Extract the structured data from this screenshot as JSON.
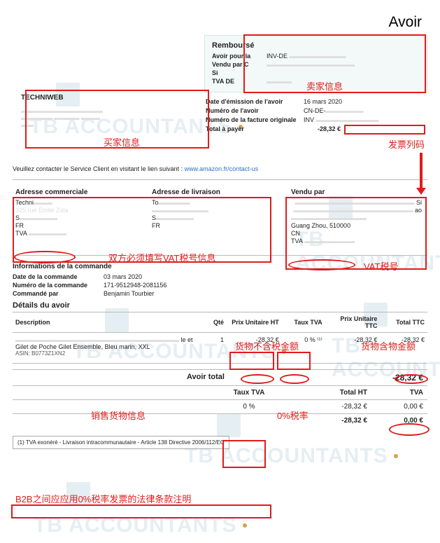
{
  "document_title": "Avoir",
  "watermark": "TB ACCOUNTANTS",
  "rembourse": {
    "heading": "Remboursé",
    "avoir_pour_label": "Avoir pour la",
    "avoir_pour_value": "INV-DE",
    "vendu_par_label": "Vendu par C",
    "si_label": "Si",
    "tva_label": "TVA DE"
  },
  "meta": {
    "date_emission_label": "Date d'émission de l'avoir",
    "date_emission_value": "16 mars 2020",
    "numero_avoir_label": "Numéro de l'avoir",
    "numero_avoir_value": "CN-DE-",
    "numero_facture_label": "Numéro de la facture originale",
    "numero_facture_value": "INV",
    "total_a_payer_label": "Total à payer",
    "total_a_payer_value": "-28,32 €"
  },
  "buyer": {
    "name": "TECHNIWEB"
  },
  "contact": {
    "text": "Veuillez contacter le Service Client en visitant le lien suivant :",
    "link_text": "www.amazon.fr/contact-us"
  },
  "addresses": {
    "commerciale": {
      "heading": "Adresse commerciale",
      "line1": "Techni",
      "line2": "325 rue Emile Zola",
      "line3": "S",
      "line4": "FR",
      "tva_label": "TVA"
    },
    "livraison": {
      "heading": "Adresse de livraison",
      "line1": "To",
      "line2": "",
      "line3": "S",
      "line4": "FR"
    },
    "vendu_par": {
      "heading": "Vendu par",
      "line1": "Si",
      "line2": "ao",
      "line4": "Guang Zhou, 510000",
      "line5": "CN",
      "tva_label": "TVA"
    }
  },
  "order_info": {
    "heading": "Informations de la commande",
    "date_label": "Date de la commande",
    "date_value": "03 mars 2020",
    "numero_label": "Numéro de la commande",
    "numero_value": "171-9512948-2081156",
    "commande_par_label": "Commandé par",
    "commande_par_value": "Benjamin Tourbier"
  },
  "details": {
    "heading": "Détails du avoir",
    "headers": {
      "description": "Description",
      "qte": "Qté",
      "prix_ht": "Prix Unitaire HT",
      "taux_tva": "Taux TVA",
      "prix_ttc": "Prix Unitaire TTC",
      "total_ttc": "Total TTC"
    },
    "items": [
      {
        "desc_suffix": "le et",
        "desc_line2": "Gilet de Poche Gilet Ensemble, Bleu marin, XXL",
        "asin": "ASIN: B0773Z1XN2",
        "qte": "1",
        "prix_ht": "-28,32 €",
        "taux_tva": "0 % ⁽¹⁾",
        "prix_ttc": "-28,32 €",
        "total_ttc": "-28,32 €"
      }
    ]
  },
  "totals": {
    "avoir_total_label": "Avoir total",
    "avoir_total_value": "-28,32 €",
    "headers": {
      "taux": "Taux TVA",
      "total_ht": "Total HT",
      "tva": "TVA"
    },
    "rows": [
      {
        "taux": "0 %",
        "total_ht": "-28,32 €",
        "tva": "0,00 €"
      }
    ],
    "sum": {
      "total_ht": "-28,32 €",
      "tva": "0,00 €"
    }
  },
  "footnote": "(1) TVA exonéré - Livraison intracommunautaire - Article 138 Directive 2006/112/EC",
  "annotations": {
    "seller_info": "卖家信息",
    "buyer_info": "买家信息",
    "invoice_list_code": "发票列码",
    "both_sides_vat": "双方必须填写VAT税号信息",
    "vat_number": "VAT税号",
    "goods_ex_tax": "货物不含税金额",
    "goods_inc_tax": "货物含物金额",
    "sales_goods_info": "销售货物信息",
    "zero_rate": "0%税率",
    "b2b_law": "B2B之间应应用0%税率发票的法律条款注明"
  }
}
